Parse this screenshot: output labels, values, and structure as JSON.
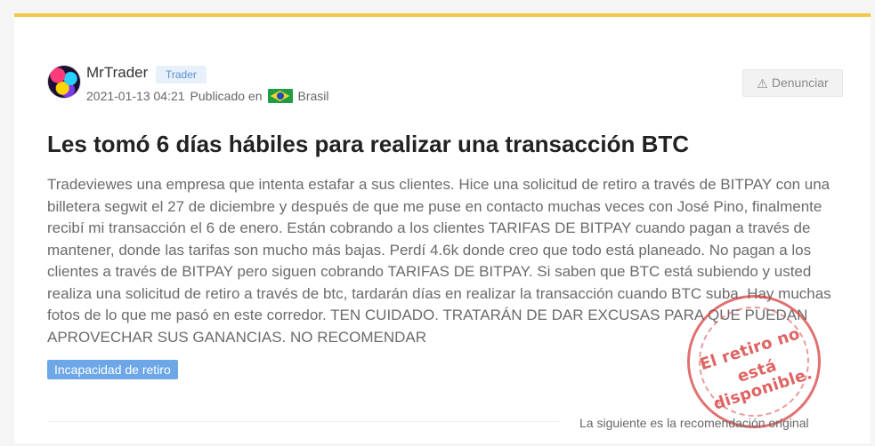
{
  "post": {
    "author": {
      "name": "MrTrader",
      "role": "Trader"
    },
    "datetime": "2021-01-13 04:21",
    "published_label": "Publicado en",
    "country": "Brasil",
    "report_label": "Denunciar",
    "title": "Les tomó 6 días hábiles para realizar una transacción BTC",
    "body": "Tradeviewes una empresa que intenta estafar a sus clientes. Hice una solicitud de retiro a través de BITPAY con una billetera segwit el 27 de diciembre y después de que me puse en contacto muchas veces con José Pino, finalmente recibí mi transacción el 6 de enero. Están cobrando a los clientes TARIFAS DE BITPAY cuando pagan a través de mantener, donde las tarifas son mucho más bajas. Perdí 4.6k donde creo que todo está planeado. No pagan a los clientes a través de BITPAY pero siguen cobrando TARIFAS DE BITPAY. Si saben que BTC está subiendo y usted realiza una solicitud de retiro a través de btc, tardarán días en realizar la transacción cuando BTC suba. Hay muchas fotos de lo que me pasó en este corredor. TEN CUIDADO. TRATARÁN DE DAR EXCUSAS PARA QUE PUEDAN APROVECHAR SUS GANANCIAS. NO RECOMENDAR",
    "tag": "Incapacidad de retiro",
    "stamp": {
      "line1": "El retiro no",
      "line2": "está disponible."
    },
    "footer_note": "La siguiente es la recomendación original"
  },
  "colors": {
    "accent": "#f2c84b",
    "tag": "#6da7e8",
    "stamp": "#d63a3a"
  },
  "icons": {
    "avatar": "avatar",
    "flag": "brazil-flag-icon",
    "report": "warning-icon"
  }
}
